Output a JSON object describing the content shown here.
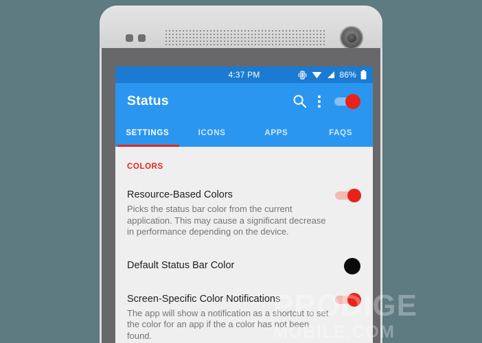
{
  "device": {
    "sensor_dot_left": "proximity-sensor",
    "sensor_dot_right": "light-sensor",
    "speaker": "earpiece-speaker-grille",
    "camera": "front-camera"
  },
  "status_bar": {
    "clock": "4:37 PM",
    "battery_percent": "86%",
    "icons": [
      "vibrate-icon",
      "wifi-icon",
      "signal-icon",
      "battery-icon"
    ],
    "background": "#1b7ad1"
  },
  "app_bar": {
    "title": "Status",
    "search_icon": "search-icon",
    "overflow_icon": "overflow-menu-icon",
    "master_switch_state": "on",
    "background": "#2b96f0",
    "accent": "#e8241a"
  },
  "tabs": [
    {
      "label": "SETTINGS",
      "active": true
    },
    {
      "label": "ICONS",
      "active": false
    },
    {
      "label": "APPS",
      "active": false
    },
    {
      "label": "FAQS",
      "active": false
    }
  ],
  "content": {
    "section_header": "COLORS",
    "rows": [
      {
        "title": "Resource-Based Colors",
        "summary": "Picks the status bar color from the current application. This may cause a significant decrease in performance depending on the device.",
        "control": "switch",
        "state": "on"
      },
      {
        "title": "Default Status Bar Color",
        "summary": "",
        "control": "color-swatch",
        "swatch_color": "#0a0a0a"
      },
      {
        "title": "Screen-Specific Color Notifications",
        "summary": "The app will show a notification as a shortcut to set the color for an app if the a color has not been found.",
        "control": "switch",
        "state": "on"
      }
    ]
  },
  "watermark": {
    "main": "PRODIGE",
    "sub": "MOBILE.COM"
  }
}
